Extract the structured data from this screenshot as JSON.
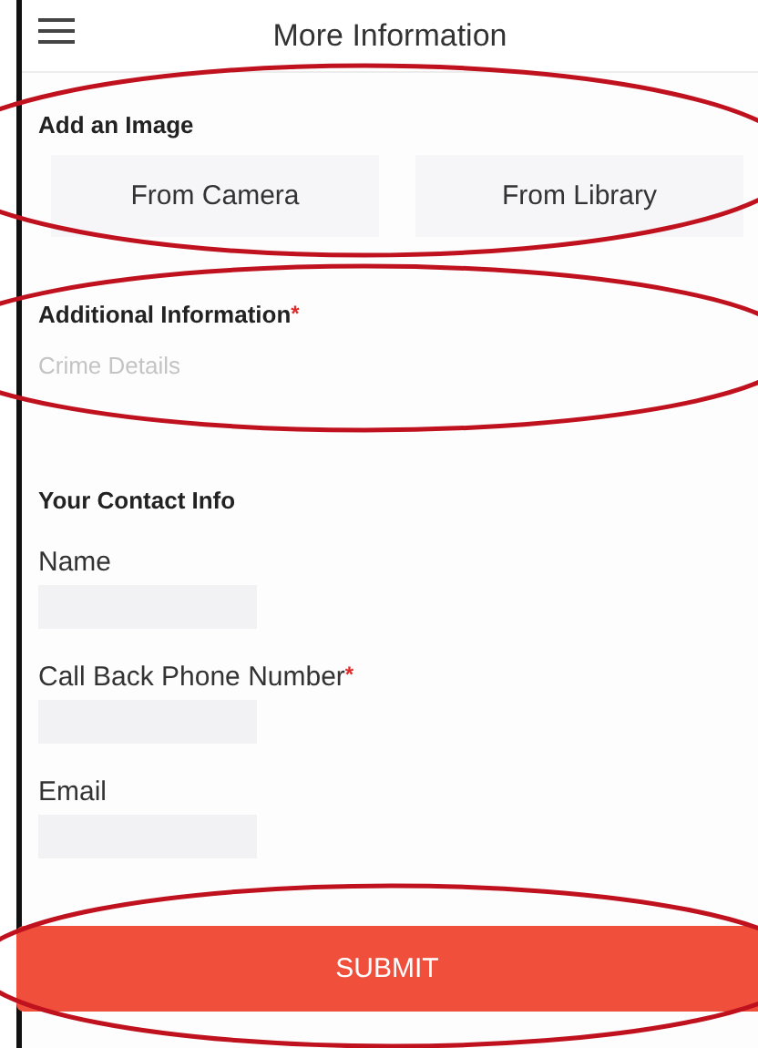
{
  "header": {
    "title": "More Information"
  },
  "image_section": {
    "title": "Add an Image",
    "buttons": [
      "From Camera",
      "From Library"
    ]
  },
  "details": {
    "label": "Additional Information",
    "marker": "*",
    "placeholder": "Crime Details"
  },
  "contact": {
    "title": "Your Contact Info",
    "fields": [
      {
        "label": "Name"
      },
      {
        "label": "Call Back Phone Number",
        "marker": "*"
      },
      {
        "label": "Email"
      }
    ]
  },
  "submit": "SUBMIT"
}
